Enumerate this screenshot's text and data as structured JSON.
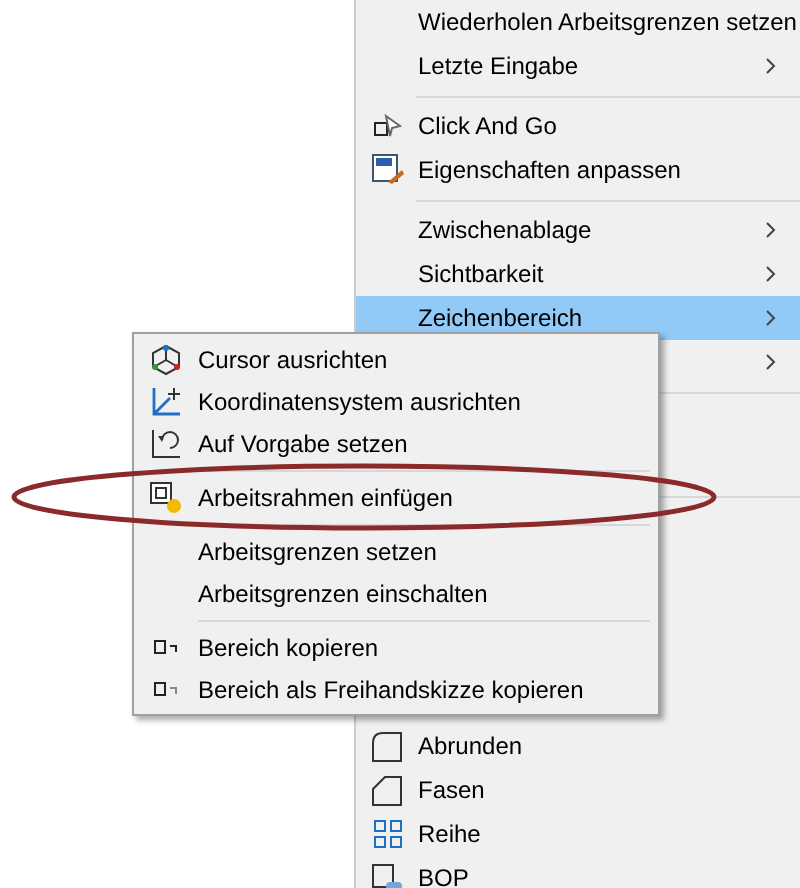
{
  "main_menu": {
    "items": [
      {
        "kind": "plain",
        "label": "Wiederholen Arbeitsgrenzen setzen",
        "selected": false
      },
      {
        "kind": "plain",
        "label": "Letzte Eingabe",
        "submenu": true,
        "selected": false
      },
      {
        "kind": "separator"
      },
      {
        "kind": "clickgo",
        "label": "Click And Go",
        "submenu": false,
        "selected": false
      },
      {
        "kind": "properties",
        "label": "Eigenschaften anpassen",
        "submenu": false,
        "selected": false
      },
      {
        "kind": "separator"
      },
      {
        "kind": "plain",
        "label": "Zwischenablage",
        "submenu": true,
        "selected": false
      },
      {
        "kind": "plain",
        "label": "Sichtbarkeit",
        "submenu": true,
        "selected": false
      },
      {
        "kind": "plain",
        "label": "Zeichenbereich",
        "submenu": true,
        "selected": true
      },
      {
        "kind": "covered",
        "submenu": true
      },
      {
        "kind": "separator"
      },
      {
        "kind": "covered"
      },
      {
        "kind": "covered"
      },
      {
        "kind": "separator"
      },
      {
        "kind": "covered"
      },
      {
        "kind": "covered"
      },
      {
        "kind": "covered"
      },
      {
        "kind": "covered"
      },
      {
        "kind": "covered"
      },
      {
        "kind": "fillet",
        "label": "Abrunden",
        "submenu": false,
        "selected": false
      },
      {
        "kind": "chamfer",
        "label": "Fasen",
        "submenu": false,
        "selected": false
      },
      {
        "kind": "pattern",
        "label": "Reihe",
        "submenu": false,
        "selected": false
      },
      {
        "kind": "bop",
        "label": "BOP",
        "submenu": false,
        "selected": false
      }
    ]
  },
  "submenu": {
    "items": [
      {
        "kind": "cursor",
        "label": "Cursor ausrichten",
        "circled": false
      },
      {
        "kind": "axes",
        "label": "Koordinatensystem ausrichten",
        "circled": false
      },
      {
        "kind": "reset",
        "label": "Auf Vorgabe setzen",
        "circled": false
      },
      {
        "kind": "separator"
      },
      {
        "kind": "frame",
        "label": "Arbeitsrahmen einfügen",
        "circled": true
      },
      {
        "kind": "separator"
      },
      {
        "kind": "plain",
        "label": "Arbeitsgrenzen setzen",
        "circled": false
      },
      {
        "kind": "plain",
        "label": "Arbeitsgrenzen einschalten",
        "circled": false
      },
      {
        "kind": "separator"
      },
      {
        "kind": "copy",
        "label": "Bereich kopieren",
        "circled": false
      },
      {
        "kind": "sketchcopy",
        "label": "Bereich als Freihandskizze kopieren",
        "circled": false
      }
    ]
  }
}
